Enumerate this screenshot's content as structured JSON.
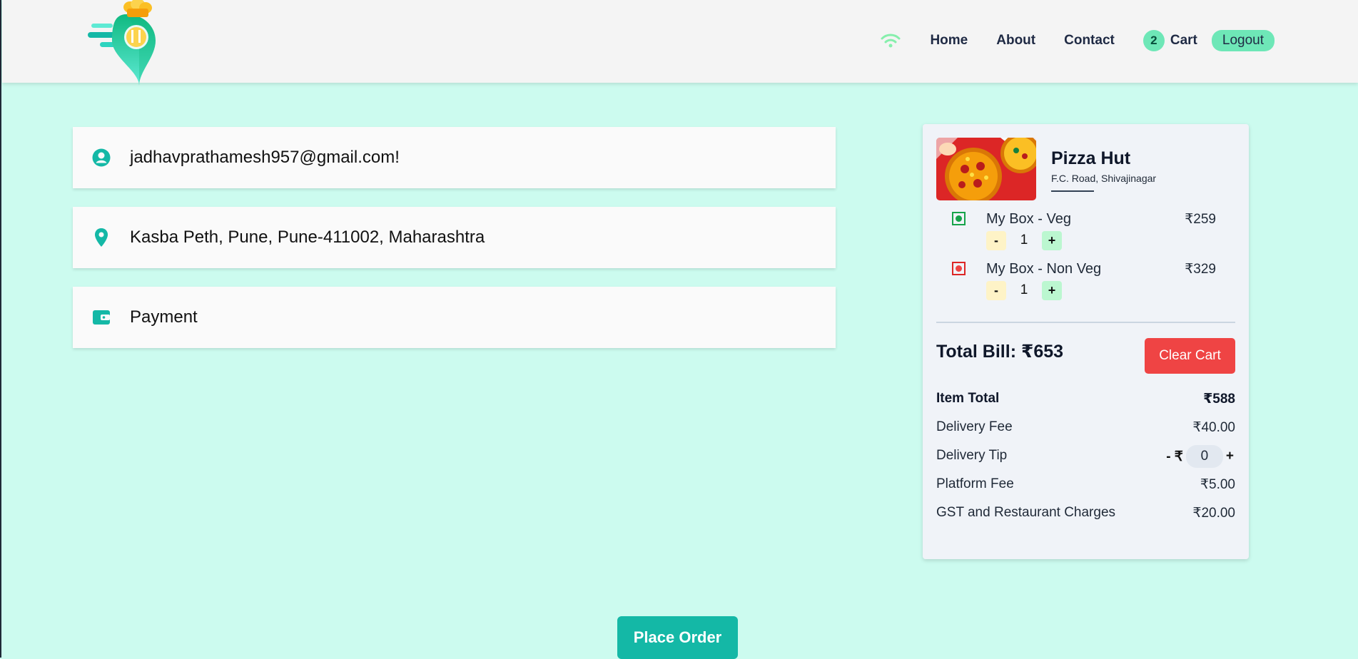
{
  "nav": {
    "links": [
      "Home",
      "About",
      "Contact"
    ],
    "cart_count": "2",
    "cart_label": "Cart",
    "logout_label": "Logout"
  },
  "info": {
    "email": "jadhavprathamesh957@gmail.com!",
    "address": "Kasba Peth, Pune, Pune-411002, Maharashtra",
    "payment": "Payment"
  },
  "cart": {
    "restaurant_name": "Pizza Hut",
    "restaurant_address": "F.C. Road, Shivajinagar",
    "items": [
      {
        "name": "My Box - Veg",
        "price": "₹259",
        "qty": "1",
        "type": "veg",
        "minus": "-",
        "plus": "+"
      },
      {
        "name": "My Box - Non Veg",
        "price": "₹329",
        "qty": "1",
        "type": "non-veg",
        "minus": "-",
        "plus": "+"
      }
    ],
    "total_bill": "Total Bill: ₹653",
    "clear_label": "Clear Cart",
    "bill": {
      "item_total_label": "Item Total",
      "item_total": "₹588",
      "delivery_fee_label": "Delivery Fee",
      "delivery_fee": "₹40.00",
      "delivery_tip_label": "Delivery Tip",
      "tip_minus": "- ₹",
      "tip_value": "0",
      "tip_plus": "+",
      "platform_fee_label": "Platform Fee",
      "platform_fee": "₹5.00",
      "gst_label": "GST and Restaurant Charges",
      "gst": "₹20.00"
    }
  },
  "place_order_label": "Place Order",
  "colors": {
    "page_bg": "#ccfbef",
    "accent": "#14b8a6",
    "veg": "#16a34a",
    "non_veg": "#dc2626",
    "clear": "#ef4444"
  },
  "icons": [
    "logo",
    "wifi-icon",
    "user-icon",
    "location-pin-icon",
    "wallet-icon"
  ]
}
